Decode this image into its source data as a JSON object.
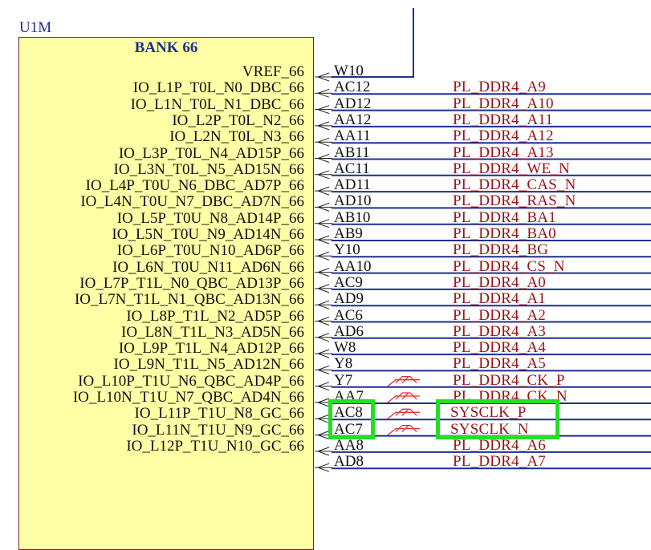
{
  "component": {
    "designator": "U1M",
    "bank": "BANK 66"
  },
  "colors": {
    "body_fill": "#ffffa6",
    "body_border": "#7a1f1f",
    "wire": "#1f2f8f",
    "net_label": "#9b1111",
    "highlight": "#22e022",
    "diff_pair_icon": "#e03030"
  },
  "pins": [
    {
      "name": "VREF_66",
      "number": "W10",
      "net": ""
    },
    {
      "name": "IO_L1P_T0L_N0_DBC_66",
      "number": "AC12",
      "net": "PL_DDR4_A9"
    },
    {
      "name": "IO_L1N_T0L_N1_DBC_66",
      "number": "AD12",
      "net": "PL_DDR4_A10"
    },
    {
      "name": "IO_L2P_T0L_N2_66",
      "number": "AA12",
      "net": "PL_DDR4_A11"
    },
    {
      "name": "IO_L2N_T0L_N3_66",
      "number": "AA11",
      "net": "PL_DDR4_A12"
    },
    {
      "name": "IO_L3P_T0L_N4_AD15P_66",
      "number": "AB11",
      "net": "PL_DDR4_A13"
    },
    {
      "name": "IO_L3N_T0L_N5_AD15N_66",
      "number": "AC11",
      "net": "PL_DDR4_WE_N"
    },
    {
      "name": "IO_L4P_T0U_N6_DBC_AD7P_66",
      "number": "AD11",
      "net": "PL_DDR4_CAS_N"
    },
    {
      "name": "IO_L4N_T0U_N7_DBC_AD7N_66",
      "number": "AD10",
      "net": "PL_DDR4_RAS_N"
    },
    {
      "name": "IO_L5P_T0U_N8_AD14P_66",
      "number": "AB10",
      "net": "PL_DDR4_BA1"
    },
    {
      "name": "IO_L5N_T0U_N9_AD14N_66",
      "number": "AB9",
      "net": "PL_DDR4_BA0"
    },
    {
      "name": "IO_L6P_T0U_N10_AD6P_66",
      "number": "Y10",
      "net": "PL_DDR4_BG"
    },
    {
      "name": "IO_L6N_T0U_N11_AD6N_66",
      "number": "AA10",
      "net": "PL_DDR4_CS_N"
    },
    {
      "name": "IO_L7P_T1L_N0_QBC_AD13P_66",
      "number": "AC9",
      "net": "PL_DDR4_A0"
    },
    {
      "name": "IO_L7N_T1L_N1_QBC_AD13N_66",
      "number": "AD9",
      "net": "PL_DDR4_A1"
    },
    {
      "name": "IO_L8P_T1L_N2_AD5P_66",
      "number": "AC6",
      "net": "PL_DDR4_A2"
    },
    {
      "name": "IO_L8N_T1L_N3_AD5N_66",
      "number": "AD6",
      "net": "PL_DDR4_A3"
    },
    {
      "name": "IO_L9P_T1L_N4_AD12P_66",
      "number": "W8",
      "net": "PL_DDR4_A4"
    },
    {
      "name": "IO_L9N_T1L_N5_AD12N_66",
      "number": "Y8",
      "net": "PL_DDR4_A5"
    },
    {
      "name": "IO_L10P_T1U_N6_QBC_AD4P_66",
      "number": "Y7",
      "net": "PL_DDR4_CK_P",
      "diff_icon": true
    },
    {
      "name": "IO_L10N_T1U_N7_QBC_AD4N_66",
      "number": "AA7",
      "net": "PL_DDR4_CK_N",
      "diff_icon": true
    },
    {
      "name": "IO_L11P_T1U_N8_GC_66",
      "number": "AC8",
      "net": "SYSCLK_P",
      "diff_icon": true,
      "highlight": true
    },
    {
      "name": "IO_L11N_T1U_N9_GC_66",
      "number": "AC7",
      "net": "SYSCLK_N",
      "diff_icon": true,
      "highlight": true
    },
    {
      "name": "IO_L12P_T1U_N10_GC_66",
      "number": "AA8",
      "net": "PL_DDR4_A6"
    },
    {
      "name": "",
      "number": "AD8",
      "net": "PL_DDR4_A7"
    }
  ]
}
